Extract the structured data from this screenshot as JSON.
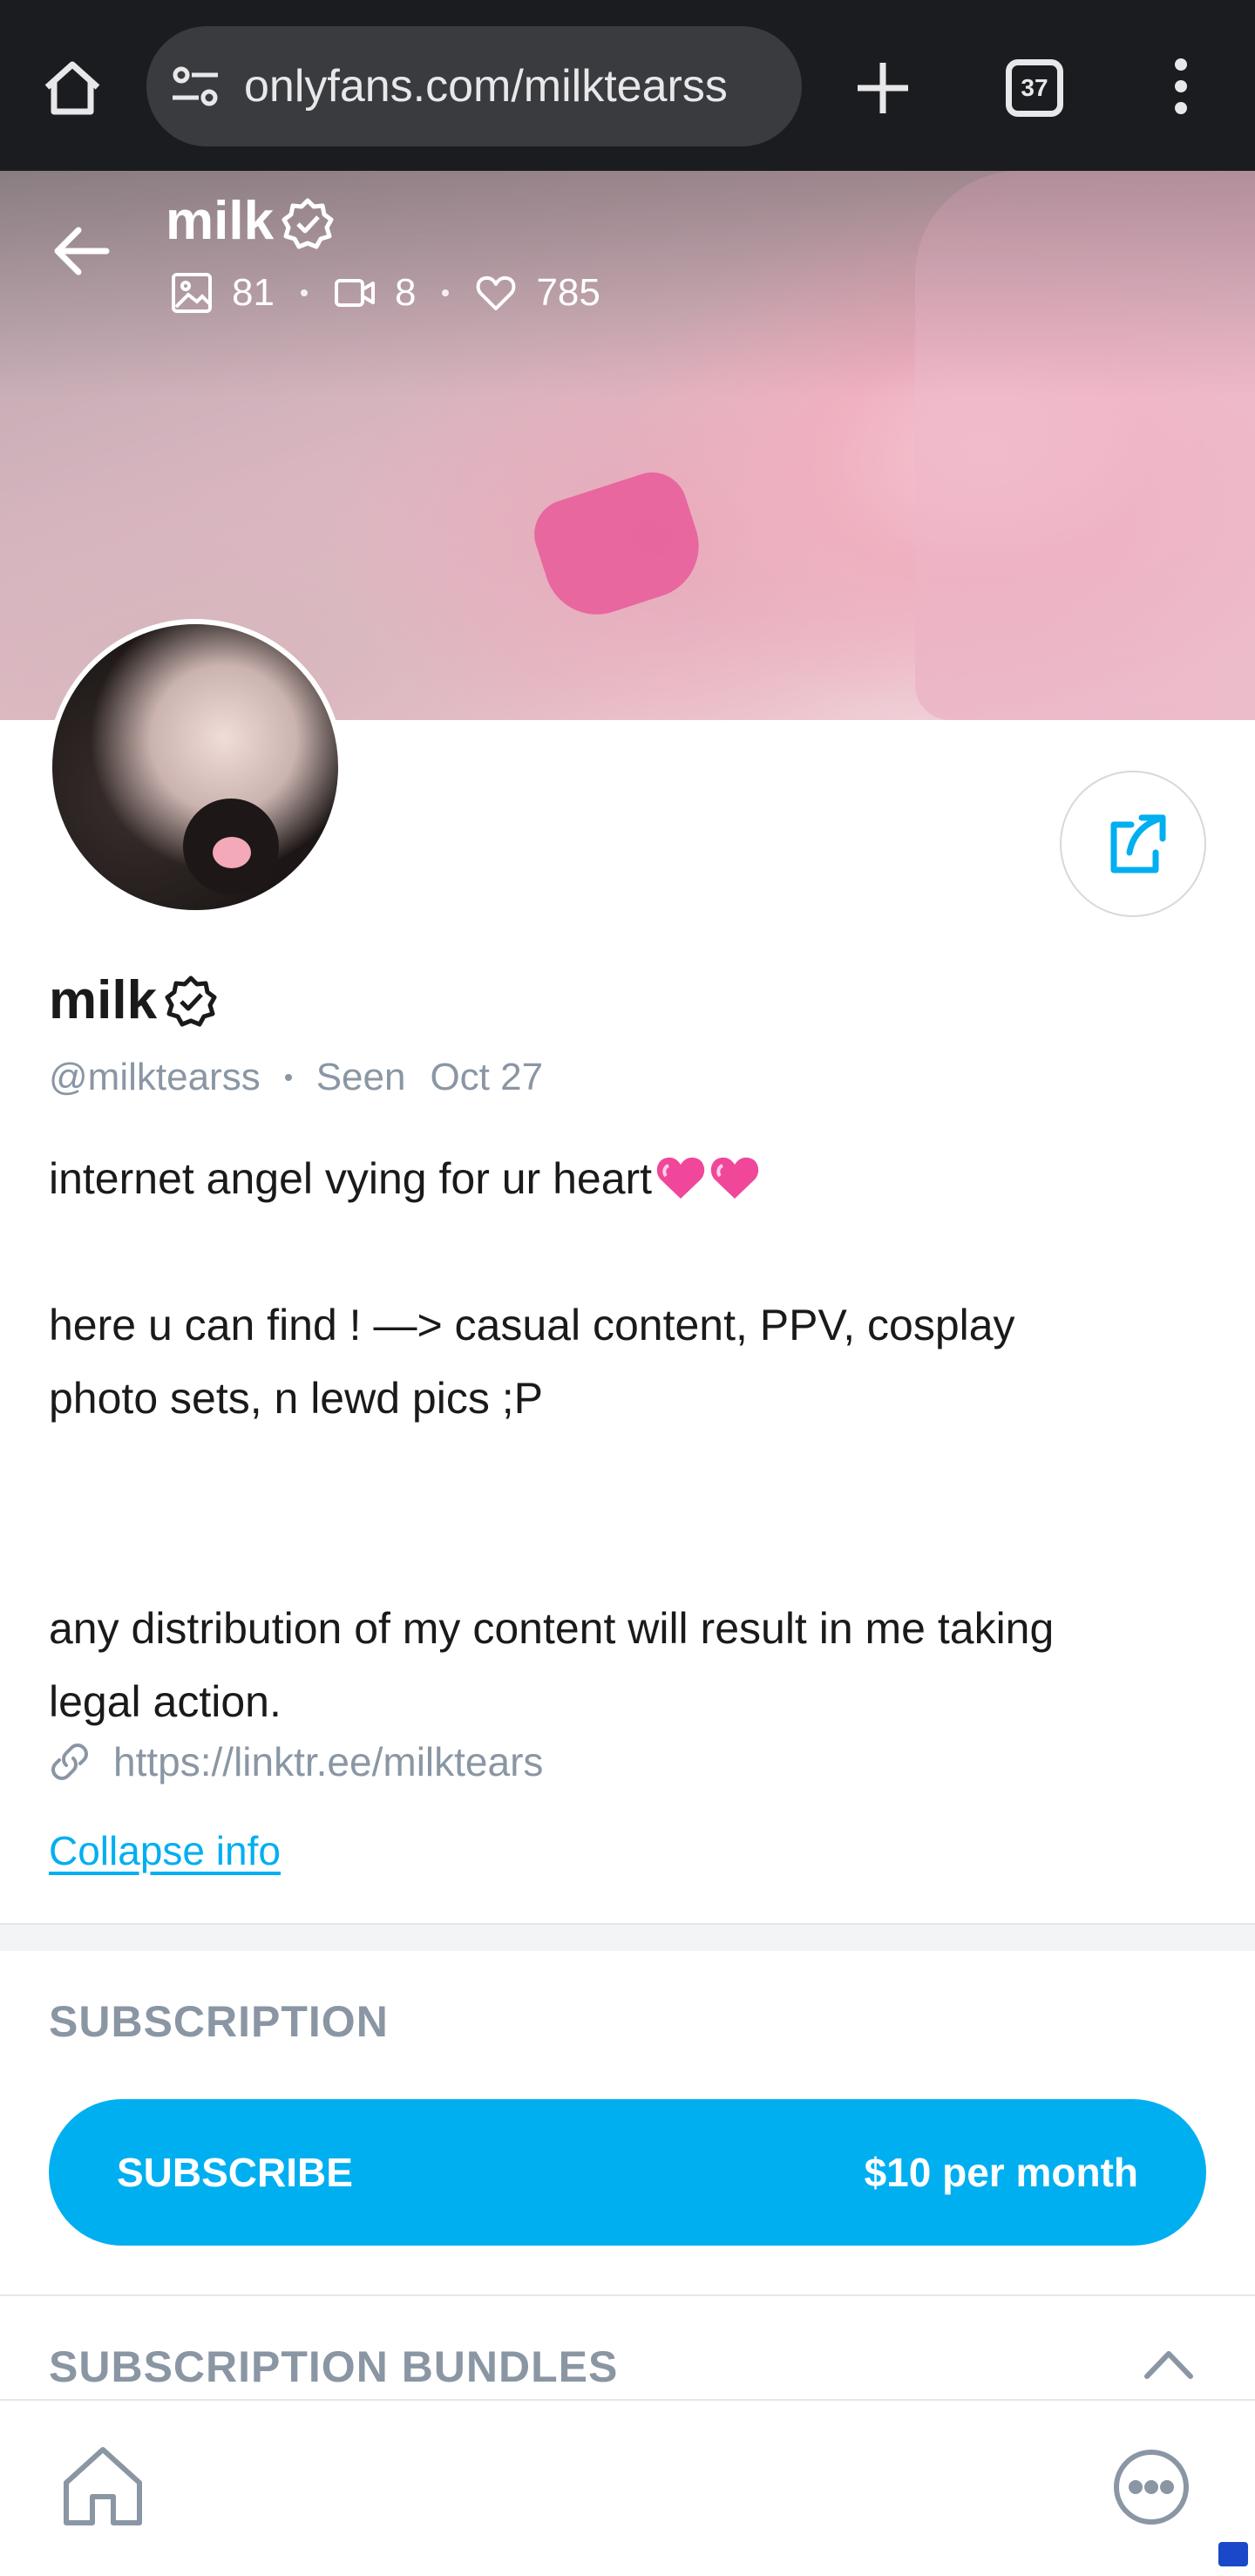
{
  "browser": {
    "url": "onlyfans.com/milktearss",
    "tab_count": "37"
  },
  "header": {
    "name": "milk",
    "stats": {
      "photos": "81",
      "videos": "8",
      "likes": "785"
    }
  },
  "profile": {
    "name": "milk",
    "handle": "@milktearss",
    "seen_label": "Seen",
    "seen_date": "Oct 27",
    "bio_line1": "internet angel vying for ur heart",
    "bio_para2": "here u can find ! —> casual content, PPV, cosplay\nphoto sets, n lewd pics ;P",
    "bio_para3": "any distribution of my content will result in me taking\nlegal action.",
    "link": "https://linktr.ee/milktears",
    "collapse_label": "Collapse info"
  },
  "subscription": {
    "section_title": "SUBSCRIPTION",
    "button_label": "SUBSCRIBE",
    "price": "$10 per month",
    "bundles_title": "SUBSCRIPTION BUNDLES"
  },
  "colors": {
    "accent": "#00aff0",
    "muted": "#8a96a3",
    "chrome_bg": "#1b1c1f"
  },
  "icons": [
    "home-icon",
    "tune-icon",
    "plus-icon",
    "tabs-icon",
    "menu-icon",
    "back-arrow-icon",
    "verified-icon",
    "photo-icon",
    "video-icon",
    "heart-icon",
    "share-icon",
    "link-icon",
    "chevron-up-icon",
    "more-icon"
  ]
}
